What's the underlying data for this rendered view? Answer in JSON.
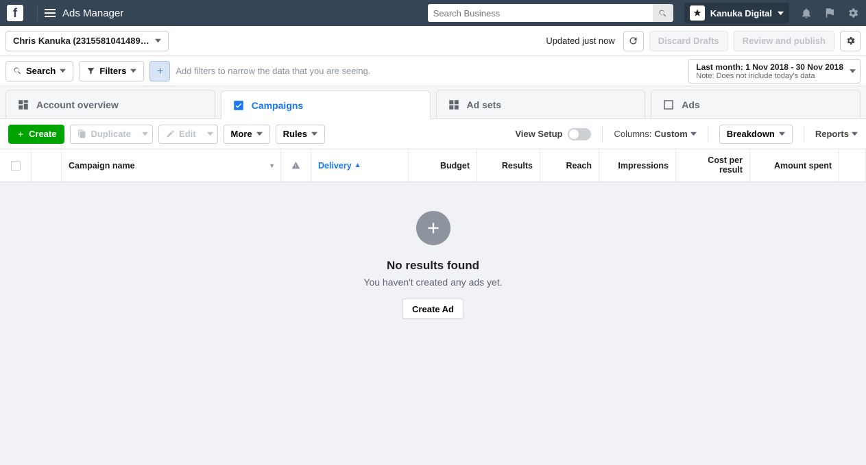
{
  "topbar": {
    "app_title": "Ads Manager",
    "search_placeholder": "Search Business",
    "business_name": "Kanuka Digital"
  },
  "subbar1": {
    "account_label": "Chris Kanuka (2315581041489…",
    "updated_text": "Updated just now",
    "discard_label": "Discard Drafts",
    "review_label": "Review and publish"
  },
  "subbar2": {
    "search_label": "Search",
    "filters_label": "Filters",
    "placeholder": "Add filters to narrow the data that you are seeing.",
    "date_main": "Last month: 1 Nov 2018 - 30 Nov 2018",
    "date_note": "Note: Does not include today's data"
  },
  "tabs": {
    "overview": "Account overview",
    "campaigns": "Campaigns",
    "adsets": "Ad sets",
    "ads": "Ads"
  },
  "actionbar": {
    "create": "Create",
    "duplicate": "Duplicate",
    "edit": "Edit",
    "more": "More",
    "rules": "Rules",
    "view_setup": "View Setup",
    "columns_label": "Columns:",
    "columns_value": "Custom",
    "breakdown": "Breakdown",
    "reports": "Reports"
  },
  "columns": {
    "name": "Campaign name",
    "delivery": "Delivery",
    "budget": "Budget",
    "results": "Results",
    "reach": "Reach",
    "impressions": "Impressions",
    "cost_per_result": "Cost per result",
    "amount_spent": "Amount spent"
  },
  "empty": {
    "title": "No results found",
    "subtitle": "You haven't created any ads yet.",
    "button": "Create Ad"
  }
}
